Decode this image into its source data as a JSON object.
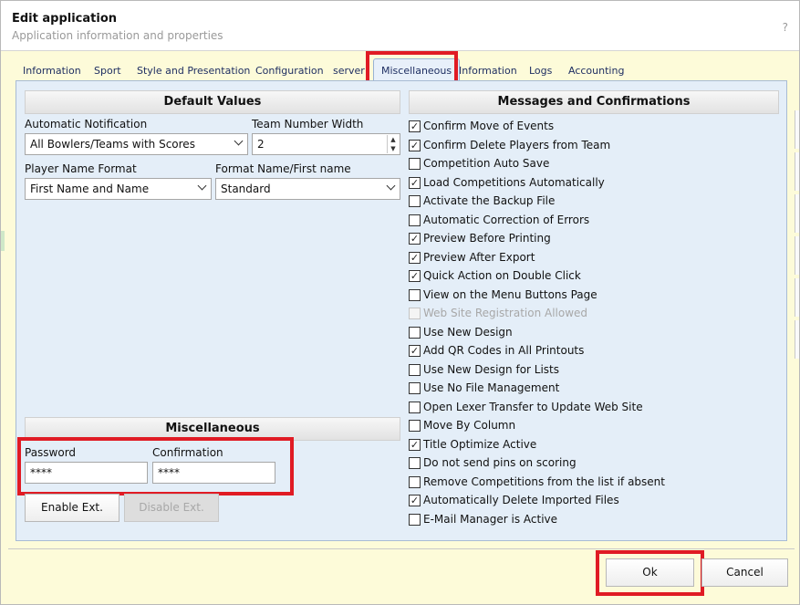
{
  "window": {
    "title": "Edit application",
    "subtitle": "Application information and properties",
    "help": "?"
  },
  "tabs": [
    {
      "label": "Information"
    },
    {
      "label": "Sport"
    },
    {
      "label": "Style and Presentation"
    },
    {
      "label": "Configuration"
    },
    {
      "label": "server"
    },
    {
      "label": "Miscellaneous"
    },
    {
      "label": "Information"
    },
    {
      "label": "Logs"
    },
    {
      "label": "Accounting"
    }
  ],
  "active_tab": "Miscellaneous",
  "default_values": {
    "header": "Default Values",
    "automatic_notification": {
      "label": "Automatic Notification",
      "value": "All Bowlers/Teams with Scores"
    },
    "team_number_width": {
      "label": "Team Number Width",
      "value": "2"
    },
    "player_name_format": {
      "label": "Player Name Format",
      "value": "First Name and Name"
    },
    "format_name_first_name": {
      "label": "Format Name/First name",
      "value": "Standard"
    }
  },
  "misc": {
    "header": "Miscellaneous",
    "password": {
      "label": "Password",
      "value": "****"
    },
    "confirmation": {
      "label": "Confirmation",
      "value": "****"
    },
    "enable_ext": "Enable Ext.",
    "disable_ext": "Disable Ext."
  },
  "messages": {
    "header": "Messages and Confirmations",
    "items": [
      {
        "label": "Confirm Move of Events",
        "checked": true,
        "disabled": false
      },
      {
        "label": "Confirm Delete Players from Team",
        "checked": true,
        "disabled": false
      },
      {
        "label": "Competition Auto Save",
        "checked": false,
        "disabled": false
      },
      {
        "label": "Load Competitions Automatically",
        "checked": true,
        "disabled": false
      },
      {
        "label": "Activate the Backup File",
        "checked": false,
        "disabled": false
      },
      {
        "label": "Automatic Correction of Errors",
        "checked": false,
        "disabled": false
      },
      {
        "label": "Preview Before Printing",
        "checked": true,
        "disabled": false
      },
      {
        "label": "Preview After Export",
        "checked": true,
        "disabled": false
      },
      {
        "label": "Quick Action on Double Click",
        "checked": true,
        "disabled": false
      },
      {
        "label": "View on the Menu Buttons Page",
        "checked": false,
        "disabled": false
      },
      {
        "label": "Web Site Registration Allowed",
        "checked": false,
        "disabled": true
      },
      {
        "label": "Use New Design",
        "checked": false,
        "disabled": false
      },
      {
        "label": "Add QR Codes in All Printouts",
        "checked": true,
        "disabled": false
      },
      {
        "label": "Use New Design for Lists",
        "checked": false,
        "disabled": false
      },
      {
        "label": "Use No File Management",
        "checked": false,
        "disabled": false
      },
      {
        "label": "Open Lexer Transfer to Update Web Site",
        "checked": false,
        "disabled": false
      },
      {
        "label": "Move By Column",
        "checked": false,
        "disabled": false
      },
      {
        "label": "Title Optimize Active",
        "checked": true,
        "disabled": false
      },
      {
        "label": "Do not send pins on scoring",
        "checked": false,
        "disabled": false
      },
      {
        "label": "Remove Competitions from the list if absent",
        "checked": false,
        "disabled": false
      },
      {
        "label": "Automatically Delete Imported Files",
        "checked": true,
        "disabled": false
      },
      {
        "label": "E-Mail Manager is Active",
        "checked": false,
        "disabled": false
      }
    ]
  },
  "footer": {
    "ok": "Ok",
    "cancel": "Cancel"
  },
  "colors": {
    "dialog_bg": "#fdfbd9",
    "panel_bg": "#e4eef8",
    "highlight": "#e01b24",
    "tab_text": "#1f2f62"
  }
}
